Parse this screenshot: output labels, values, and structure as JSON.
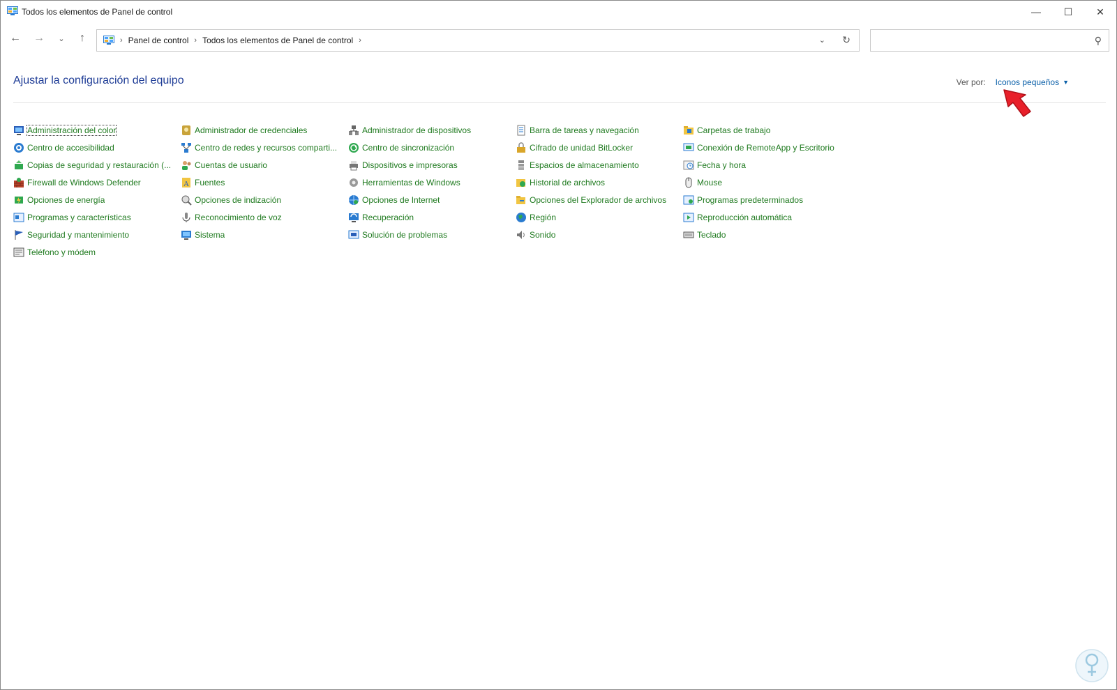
{
  "window": {
    "title": "Todos los elementos de Panel de control",
    "controls": {
      "minimize": "—",
      "maximize": "☐",
      "close": "✕"
    }
  },
  "nav": {
    "back": "←",
    "forward": "→",
    "history": "⌄",
    "up": "↑",
    "breadcrumbs": [
      "Panel de control",
      "Todos los elementos de Panel de control"
    ],
    "sep": "›",
    "dropdown": "⌄",
    "refresh": "↻"
  },
  "search": {
    "value": "",
    "placeholder": "",
    "icon": "⚲"
  },
  "header": {
    "title": "Ajustar la configuración del equipo",
    "view_by_label": "Ver por:",
    "view_by_value": "Iconos pequeños",
    "caret": "▼"
  },
  "colors": {
    "link_green": "#1f7a1f",
    "title_blue": "#1e3c96",
    "accent_blue": "#0a5fa8",
    "pointer_red": "#e8202a"
  },
  "items": [
    {
      "label": "Administración del color",
      "icon": "color-management-icon",
      "focused": true
    },
    {
      "label": "Administrador de credenciales",
      "icon": "credential-manager-icon"
    },
    {
      "label": "Administrador de dispositivos",
      "icon": "device-manager-icon"
    },
    {
      "label": "Barra de tareas y navegación",
      "icon": "taskbar-icon"
    },
    {
      "label": "Carpetas de trabajo",
      "icon": "work-folders-icon"
    },
    {
      "label": "Centro de accesibilidad",
      "icon": "accessibility-icon"
    },
    {
      "label": "Centro de redes y recursos comparti...",
      "icon": "network-center-icon"
    },
    {
      "label": "Centro de sincronización",
      "icon": "sync-center-icon"
    },
    {
      "label": "Cifrado de unidad BitLocker",
      "icon": "bitlocker-icon"
    },
    {
      "label": "Conexión de RemoteApp y Escritorio",
      "icon": "remoteapp-icon"
    },
    {
      "label": "Copias de seguridad y restauración (...",
      "icon": "backup-icon"
    },
    {
      "label": "Cuentas de usuario",
      "icon": "user-accounts-icon"
    },
    {
      "label": "Dispositivos e impresoras",
      "icon": "devices-printers-icon"
    },
    {
      "label": "Espacios de almacenamiento",
      "icon": "storage-spaces-icon"
    },
    {
      "label": "Fecha y hora",
      "icon": "date-time-icon"
    },
    {
      "label": "Firewall de Windows Defender",
      "icon": "firewall-icon"
    },
    {
      "label": "Fuentes",
      "icon": "fonts-icon"
    },
    {
      "label": "Herramientas de Windows",
      "icon": "windows-tools-icon"
    },
    {
      "label": "Historial de archivos",
      "icon": "file-history-icon"
    },
    {
      "label": "Mouse",
      "icon": "mouse-icon"
    },
    {
      "label": "Opciones de energía",
      "icon": "power-options-icon"
    },
    {
      "label": "Opciones de indización",
      "icon": "indexing-icon"
    },
    {
      "label": "Opciones de Internet",
      "icon": "internet-options-icon"
    },
    {
      "label": "Opciones del Explorador de archivos",
      "icon": "explorer-options-icon"
    },
    {
      "label": "Programas predeterminados",
      "icon": "default-programs-icon"
    },
    {
      "label": "Programas y características",
      "icon": "programs-features-icon"
    },
    {
      "label": "Reconocimiento de voz",
      "icon": "speech-recognition-icon"
    },
    {
      "label": "Recuperación",
      "icon": "recovery-icon"
    },
    {
      "label": "Región",
      "icon": "region-icon"
    },
    {
      "label": "Reproducción automática",
      "icon": "autoplay-icon"
    },
    {
      "label": "Seguridad y mantenimiento",
      "icon": "security-maintenance-icon"
    },
    {
      "label": "Sistema",
      "icon": "system-icon"
    },
    {
      "label": "Solución de problemas",
      "icon": "troubleshooting-icon"
    },
    {
      "label": "Sonido",
      "icon": "sound-icon"
    },
    {
      "label": "Teclado",
      "icon": "keyboard-icon"
    },
    {
      "label": "Teléfono y módem",
      "icon": "phone-modem-icon"
    }
  ]
}
